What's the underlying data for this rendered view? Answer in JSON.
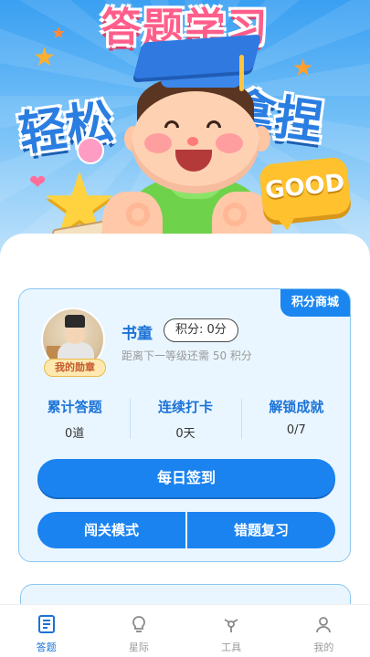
{
  "banner": {
    "title": "答题学习",
    "slogan_left": "轻松",
    "slogan_right": "拿捏",
    "speech_bubble": "GOOD"
  },
  "card": {
    "mall_badge": "积分商城",
    "medal_label": "我的勋章",
    "username": "书童",
    "points": "积分: 0分",
    "level_hint": "距离下一等级还需 50 积分",
    "stats": [
      {
        "label": "累计答题",
        "value": "0道"
      },
      {
        "label": "连续打卡",
        "value": "0天"
      },
      {
        "label": "解锁成就",
        "value": "0/7"
      }
    ],
    "checkin_label": "每日签到",
    "challenge_label": "闯关模式",
    "review_label": "错题复习"
  },
  "bottom_nav": [
    {
      "label": "答题",
      "icon": "quiz-icon",
      "active": true
    },
    {
      "label": "星际",
      "icon": "bulb-icon",
      "active": false
    },
    {
      "label": "工具",
      "icon": "tools-icon",
      "active": false
    },
    {
      "label": "我的",
      "icon": "profile-icon",
      "active": false
    }
  ],
  "colors": {
    "primary": "#1a83f0",
    "card_bg": "#eaf6ff",
    "title_pink": "#ff5e8a"
  }
}
